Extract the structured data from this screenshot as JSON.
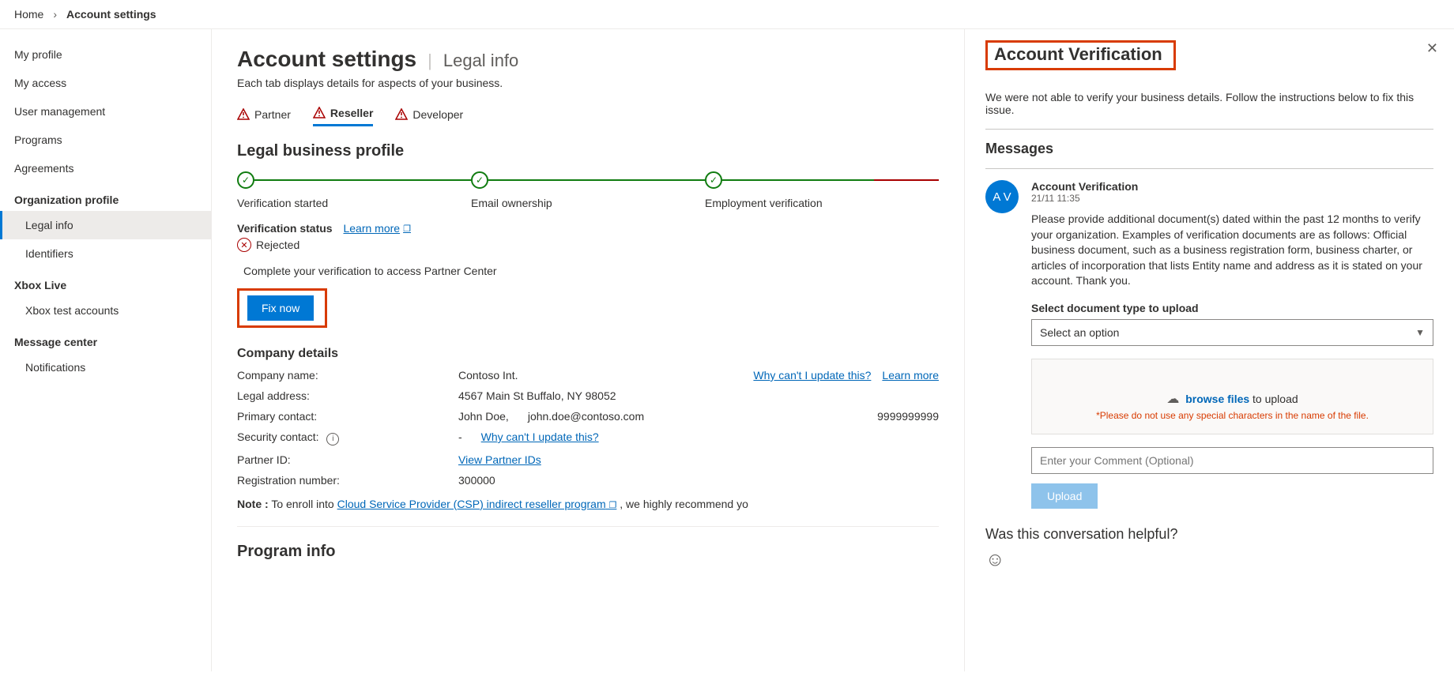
{
  "breadcrumb": {
    "home": "Home",
    "current": "Account settings"
  },
  "sidebar": {
    "items": [
      "My profile",
      "My access",
      "User management",
      "Programs",
      "Agreements"
    ],
    "orgHeading": "Organization profile",
    "org": [
      "Legal info",
      "Identifiers"
    ],
    "xboxHeading": "Xbox Live",
    "xbox": [
      "Xbox test accounts"
    ],
    "msgHeading": "Message center",
    "msg": [
      "Notifications"
    ]
  },
  "page": {
    "title": "Account settings",
    "subtitle": "Legal info",
    "desc": "Each tab displays details for aspects of your business."
  },
  "tabs": [
    "Partner",
    "Reseller",
    "Developer"
  ],
  "profile": {
    "heading": "Legal business profile",
    "steps": [
      "Verification started",
      "Email ownership",
      "Employment verification"
    ],
    "statusLabel": "Verification status",
    "learnMore": "Learn more",
    "rejected": "Rejected",
    "completeMsg": "Complete your verification to access Partner Center",
    "fixNow": "Fix now"
  },
  "company": {
    "heading": "Company details",
    "rows": {
      "nameLabel": "Company name:",
      "nameValue": "Contoso Int.",
      "whyUpdate": "Why can't I update this?",
      "learnMore": "Learn more",
      "addrLabel": "Legal address:",
      "addrValue": "4567 Main St Buffalo, NY 98052",
      "contactLabel": "Primary contact:",
      "contactName": "John Doe,",
      "contactEmail": "john.doe@contoso.com",
      "contactPhone": "9999999999",
      "secLabel": "Security contact:",
      "secDash": "-",
      "secLink": "Why can't I update this?",
      "pidLabel": "Partner ID:",
      "pidLink": "View Partner IDs",
      "regLabel": "Registration number:",
      "regValue": "300000"
    },
    "noteLabel": "Note :",
    "noteBefore": "To enroll into ",
    "noteLink": "Cloud Service Provider (CSP) indirect reseller program",
    "noteAfter": ", we highly recommend yo",
    "programInfo": "Program info"
  },
  "panel": {
    "title": "Account Verification",
    "lead": "We were not able to verify your business details. Follow the instructions below to fix this issue.",
    "messagesHeading": "Messages",
    "avatar": "A V",
    "msgTitle": "Account Verification",
    "msgTime": "21/11 11:35",
    "msgText": "Please provide additional document(s) dated within the past 12 months to verify your organization. Examples of verification documents are as follows: Official business document, such as a business registration form, business charter, or articles of incorporation that lists Entity name and address as it is stated on your account. Thank you.",
    "selectLabel": "Select document type to upload",
    "selectPlaceholder": "Select an option",
    "browse": "browse files",
    "toUpload": " to upload",
    "uploadWarn": "*Please do not use any special characters in the name of the file.",
    "commentPlaceholder": "Enter your Comment (Optional)",
    "uploadBtn": "Upload",
    "helpful": "Was this conversation helpful?"
  }
}
